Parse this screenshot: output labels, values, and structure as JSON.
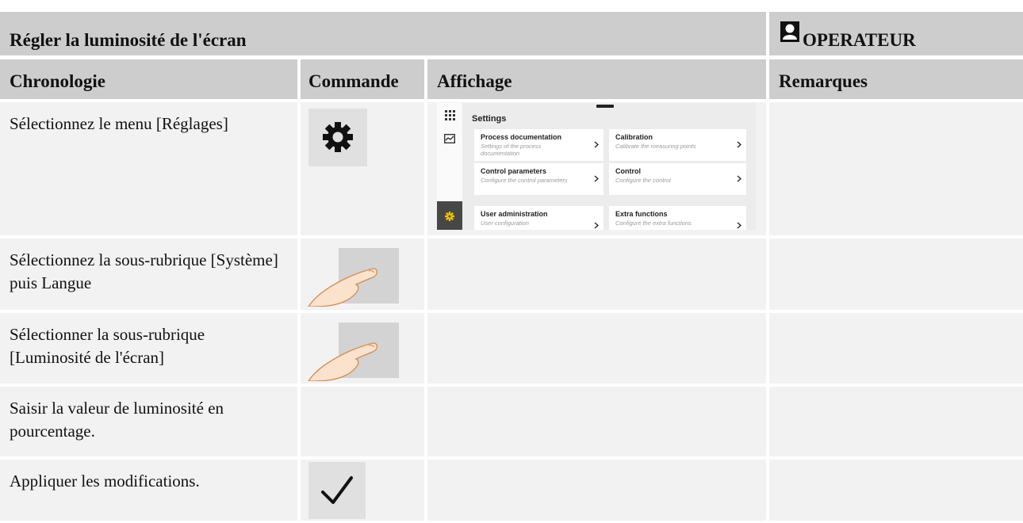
{
  "title_row": {
    "title": "Régler la luminosité de l'écran",
    "role": "OPERATEUR"
  },
  "columns": {
    "chronologie": "Chronologie",
    "commande": "Commande",
    "affichage": "Affichage",
    "remarques": "Remarques"
  },
  "rows": [
    {
      "step": "Sélectionnez le menu [Réglages]",
      "command_icon": "gear-icon"
    },
    {
      "step": "Sélectionnez la sous-rubrique [Système] puis Langue",
      "command_icon": "finger-tap-icon"
    },
    {
      "step": "Sélectionner la sous-rubrique [Luminosité de l'écran]",
      "command_icon": "finger-tap-icon"
    },
    {
      "step": "Saisir la valeur de luminosité en pourcentage.",
      "command_icon": ""
    },
    {
      "step": "Appliquer les modifications.",
      "command_icon": "checkmark-icon"
    }
  ],
  "settings_screen": {
    "title": "Settings",
    "cards": [
      {
        "title": "Process documentation",
        "subtitle": "Settings of the process documentation"
      },
      {
        "title": "Calibration",
        "subtitle": "Calibrate the measuring points"
      },
      {
        "title": "Control parameters",
        "subtitle": "Configure the control parameters"
      },
      {
        "title": "Control",
        "subtitle": "Configure the control"
      },
      {
        "title": "User administration",
        "subtitle": "User configuration"
      },
      {
        "title": "Extra functions",
        "subtitle": "Configure the extra functions"
      }
    ]
  },
  "colors": {
    "header_bg": "#cdcdcd",
    "cell_bg": "#f2f2f2",
    "gear_accent": "#f2c200"
  }
}
